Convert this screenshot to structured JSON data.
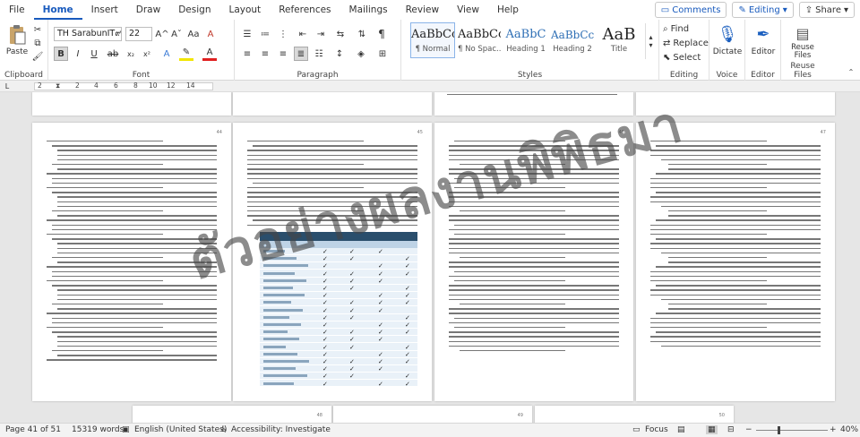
{
  "menu": {
    "tabs": [
      "File",
      "Home",
      "Insert",
      "Draw",
      "Design",
      "Layout",
      "References",
      "Mailings",
      "Review",
      "View",
      "Help"
    ],
    "active": "Home",
    "comments": "Comments",
    "editing": "Editing",
    "share": "Share"
  },
  "ribbon": {
    "clipboard": {
      "label": "Clipboard",
      "paste": "Paste"
    },
    "font": {
      "label": "Font",
      "name": "TH SarabunIT๙",
      "size": "22",
      "bold": "B",
      "italic": "I",
      "underline": "U",
      "grow": "A^",
      "shrink": "Aˇ",
      "case": "Aa",
      "clear": "A"
    },
    "paragraph": {
      "label": "Paragraph",
      "pilcrow": "¶"
    },
    "styles": {
      "label": "Styles",
      "items": [
        {
          "preview": "AaBbCcI",
          "name": "¶ Normal"
        },
        {
          "preview": "AaBbCcI",
          "name": "¶ No Spac..."
        },
        {
          "preview": "AaBbC",
          "name": "Heading 1"
        },
        {
          "preview": "AaBbCc",
          "name": "Heading 2"
        },
        {
          "preview": "AaB",
          "name": "Title"
        }
      ]
    },
    "editing": {
      "label": "Editing",
      "find": "Find",
      "replace": "Replace",
      "select": "Select"
    },
    "voice": {
      "label": "Voice",
      "dictate": "Dictate"
    },
    "editor": {
      "label": "Editor",
      "editor": "Editor"
    },
    "reuse": {
      "label": "Reuse Files",
      "reuse": "Reuse\nFiles"
    }
  },
  "ruler": {
    "ticks": [
      "2",
      "",
      "2",
      "4",
      "6",
      "8",
      "10",
      "12",
      "14"
    ]
  },
  "pages": {
    "numbers": [
      "44",
      "45",
      "46",
      "47",
      "48",
      "49",
      "50",
      "51"
    ]
  },
  "watermark": "ตัวอย่างผลงานพิพิธมา",
  "status": {
    "page": "Page 41 of 51",
    "words": "15319 words",
    "language": "English (United States)",
    "accessibility": "Accessibility: Investigate",
    "focus": "Focus",
    "zoom": "40%"
  },
  "colors": {
    "accent": "#185abd",
    "table_head": "#2a4e6c",
    "table_sub": "#bed3e6",
    "table_body": "#e9f1f8"
  }
}
